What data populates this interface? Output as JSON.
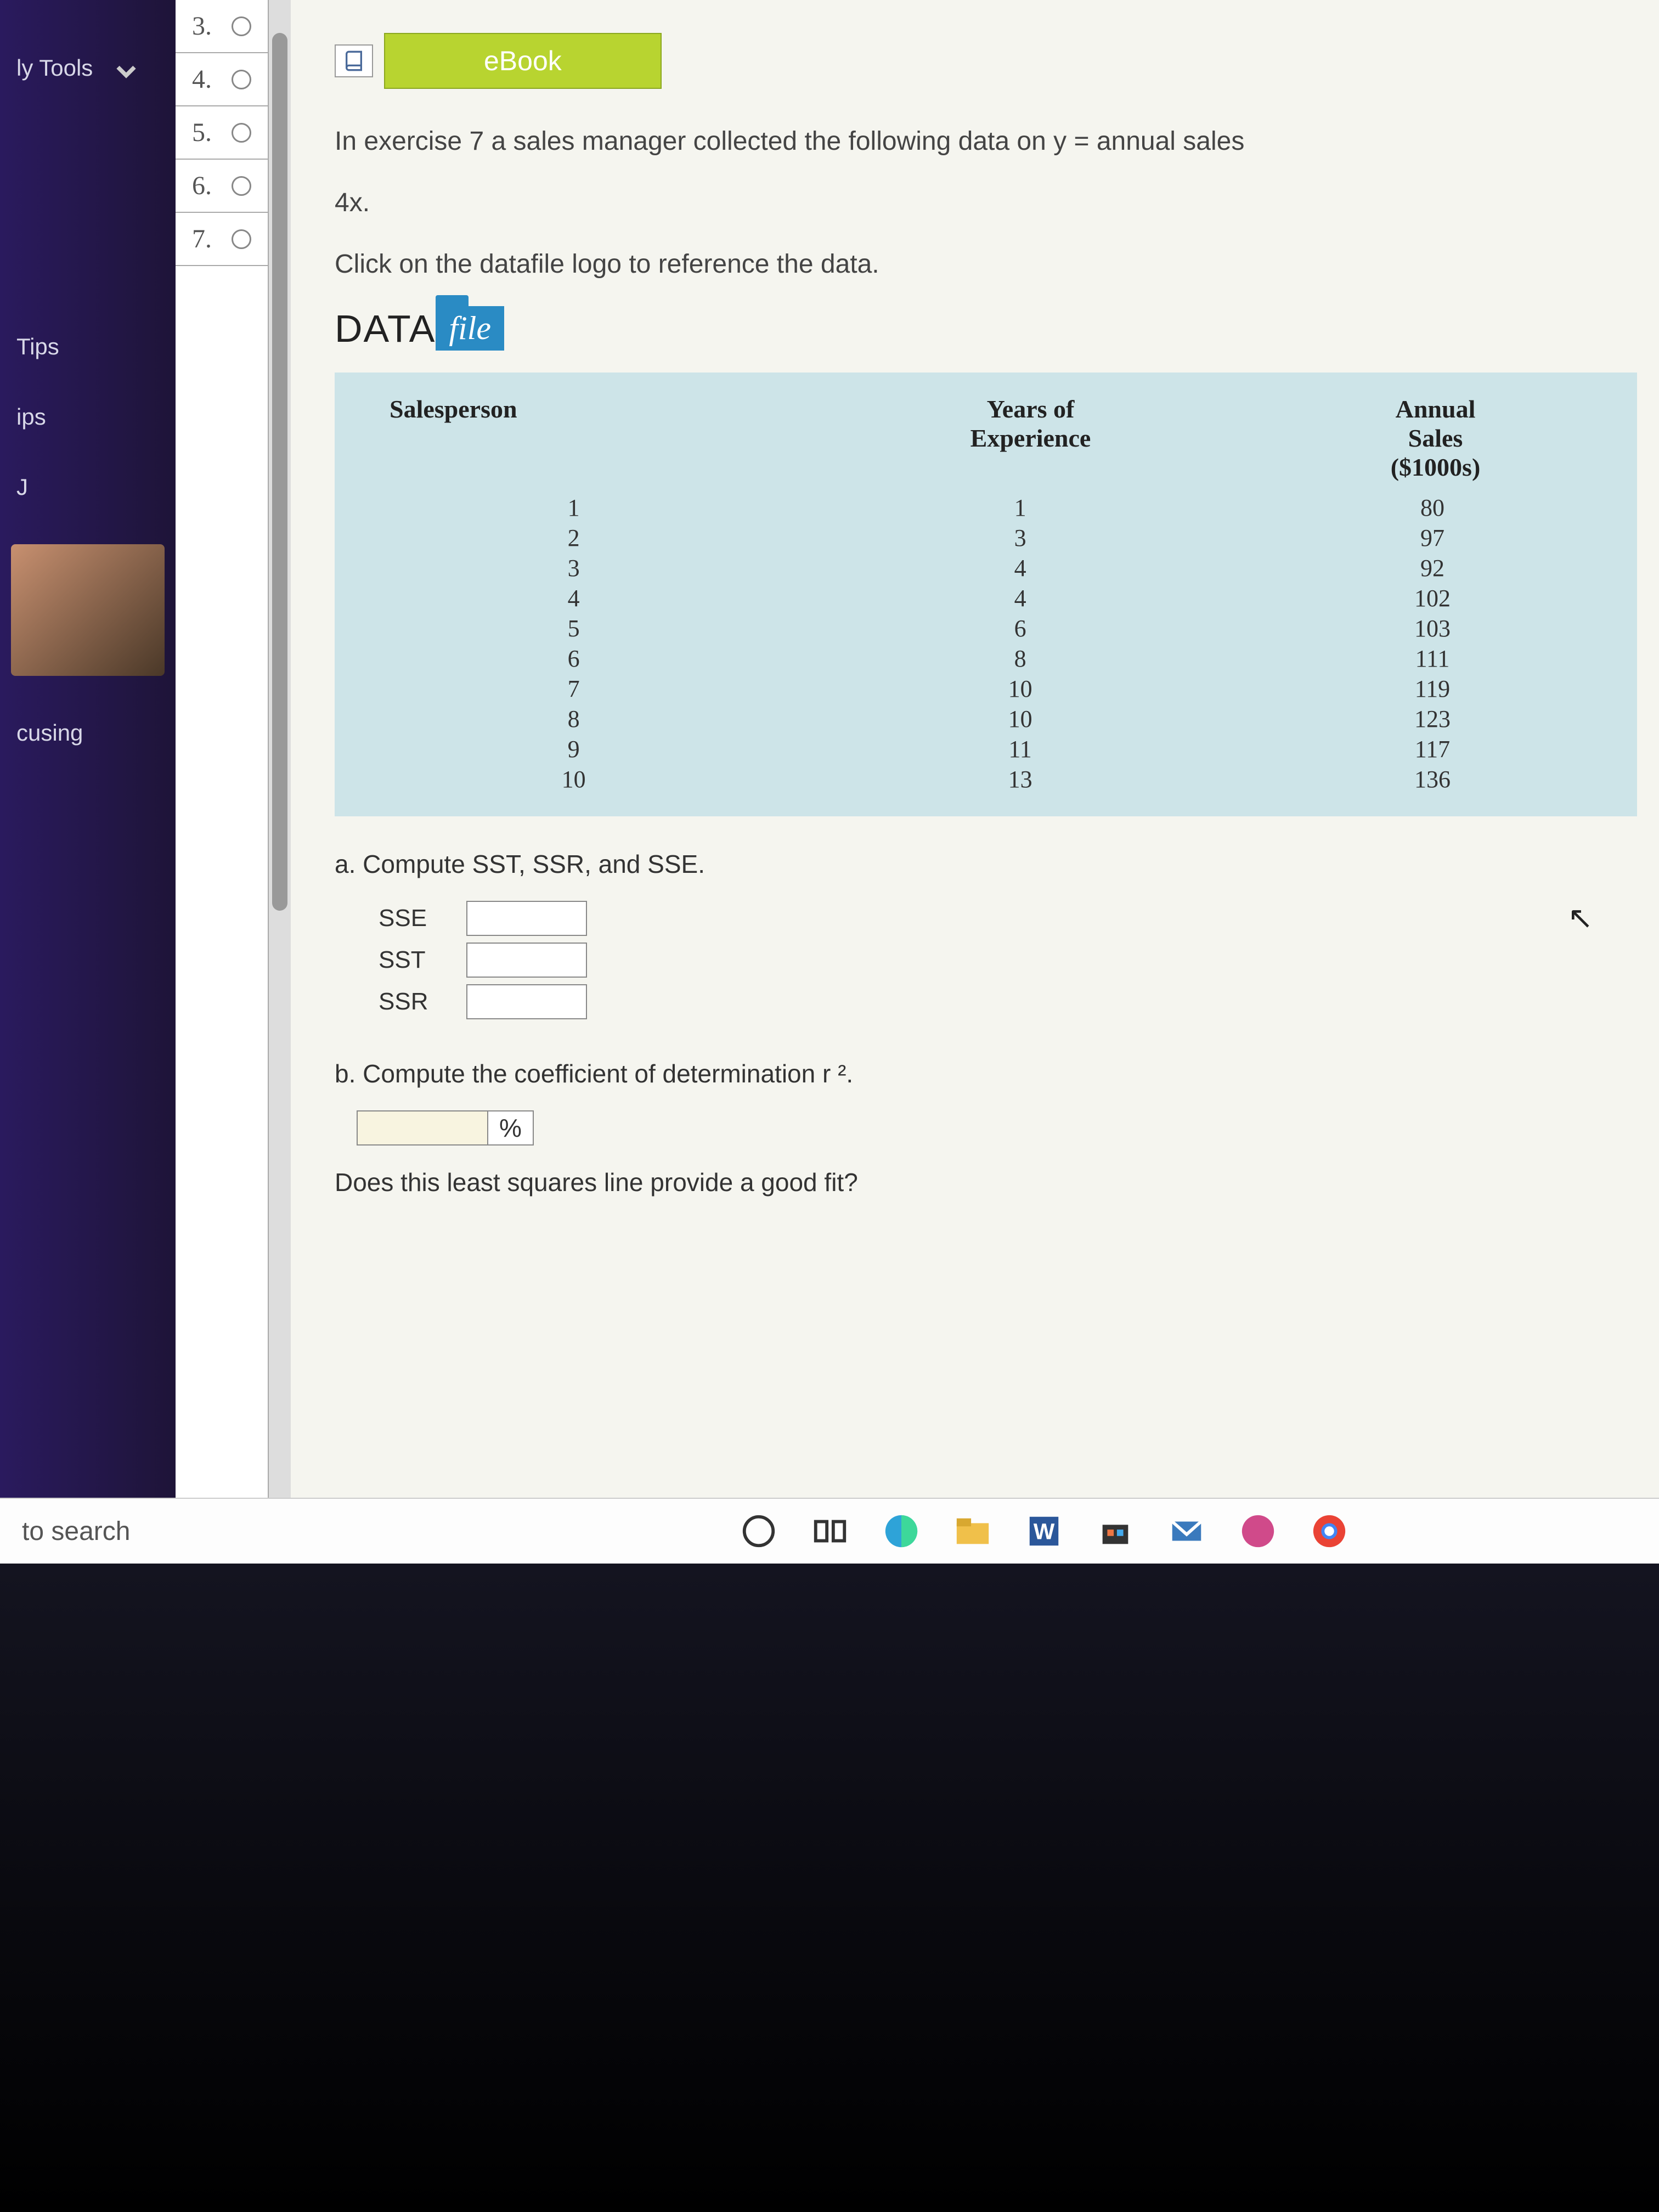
{
  "sidebar": {
    "items": [
      "ly Tools",
      "Tips",
      "ips",
      "J",
      "cusing"
    ]
  },
  "qnav": {
    "numbers": [
      "3.",
      "4.",
      "5.",
      "6.",
      "7."
    ]
  },
  "ebook": {
    "label": "eBook"
  },
  "intro1": "In exercise 7 a sales manager collected the following data on y = annual sales",
  "intro2": "4x.",
  "intro3": "Click on the datafile logo to reference the data.",
  "datafile": {
    "data": "DATA",
    "file": "file"
  },
  "table": {
    "headers": [
      "Salesperson",
      "Years of\nExperience",
      "Annual\nSales\n($1000s)"
    ],
    "rows": [
      [
        "1",
        "1",
        "80"
      ],
      [
        "2",
        "3",
        "97"
      ],
      [
        "3",
        "4",
        "92"
      ],
      [
        "4",
        "4",
        "102"
      ],
      [
        "5",
        "6",
        "103"
      ],
      [
        "6",
        "8",
        "111"
      ],
      [
        "7",
        "10",
        "119"
      ],
      [
        "8",
        "10",
        "123"
      ],
      [
        "9",
        "11",
        "117"
      ],
      [
        "10",
        "13",
        "136"
      ]
    ]
  },
  "qa": {
    "prompt": "a. Compute SST, SSR, and SSE.",
    "labels": [
      "SSE",
      "SST",
      "SSR"
    ]
  },
  "qb": {
    "prompt": "b. Compute the coefficient of determination r ².",
    "pct": "%",
    "followup": "Does this least squares line provide a good fit?"
  },
  "taskbar": {
    "search": "to search"
  },
  "chart_data": {
    "type": "table",
    "title": "Sales experience vs annual sales",
    "columns": [
      "Salesperson",
      "Years of Experience",
      "Annual Sales ($1000s)"
    ],
    "rows": [
      [
        1,
        1,
        80
      ],
      [
        2,
        3,
        97
      ],
      [
        3,
        4,
        92
      ],
      [
        4,
        4,
        102
      ],
      [
        5,
        6,
        103
      ],
      [
        6,
        8,
        111
      ],
      [
        7,
        10,
        119
      ],
      [
        8,
        10,
        123
      ],
      [
        9,
        11,
        117
      ],
      [
        10,
        13,
        136
      ]
    ]
  }
}
